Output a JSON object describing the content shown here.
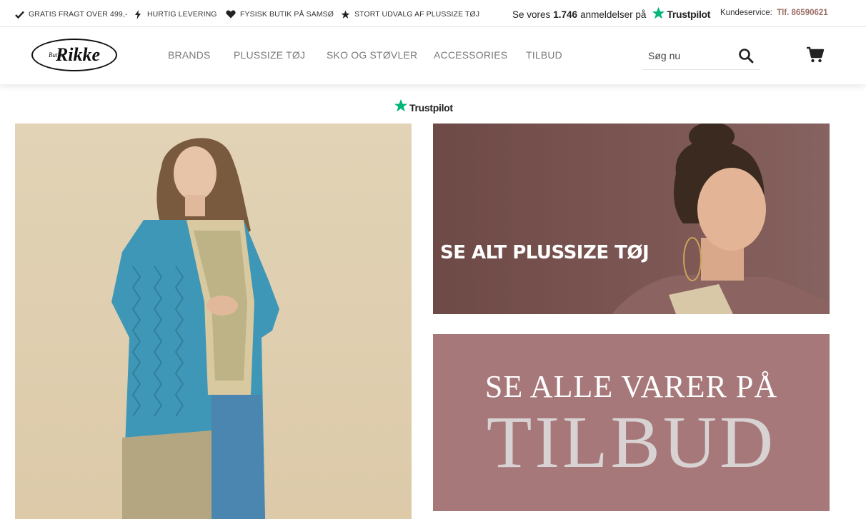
{
  "topbar": {
    "usps": [
      {
        "icon": "checkmark-icon",
        "label": "GRATIS FRAGT OVER 499,-"
      },
      {
        "icon": "lightning-icon",
        "label": "HURTIG LEVERING"
      },
      {
        "icon": "heart-icon",
        "label": "FYSISK BUTIK PÅ SAMSØ"
      },
      {
        "icon": "star-icon",
        "label": "STORT UDVALG AF PLUSSIZE TØJ"
      }
    ],
    "trustpilot": {
      "prefix": "Se vores",
      "count": "1.746",
      "suffix": "anmeldelser på",
      "brand": "Trustpilot"
    },
    "service": {
      "label": "Kundeservice:",
      "phone": "Tlf. 86590621"
    }
  },
  "header": {
    "logo_text": "Rikke",
    "logo_small": "Butik",
    "nav": [
      "BRANDS",
      "PLUSSIZE TØJ",
      "SKO OG STØVLER",
      "ACCESSORIES",
      "TILBUD"
    ],
    "search": {
      "placeholder": "Søg nu",
      "value": ""
    }
  },
  "trustpilot_widget": {
    "brand": "Trustpilot"
  },
  "banners": {
    "plussize": {
      "label": "SE ALT PLUSSIZE TØJ"
    },
    "tilbud": {
      "line1": "SE ALLE VARER PÅ",
      "line2": "TILBUD"
    }
  },
  "colors": {
    "trustpilot_green": "#00b67a",
    "phone_accent": "#9a6f66",
    "banner1_bg": "#7a5451",
    "banner2_bg": "#a7787a"
  }
}
